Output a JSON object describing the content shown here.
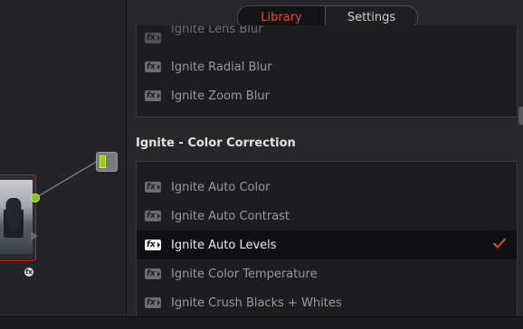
{
  "tabs": {
    "library": "Library",
    "settings": "Settings"
  },
  "colors": {
    "accent_red": "#e0493c",
    "node_green": "#8cc31b",
    "node_border_red": "#b8251c"
  },
  "node_editor": {
    "source_node_icon": "fx-badge-icon",
    "output_node_icon": "output-node-icon"
  },
  "blur_section": {
    "items": [
      {
        "label": "Ignite Lens Blur",
        "icon": "fx-icon"
      },
      {
        "label": "Ignite Radial Blur",
        "icon": "fx-icon"
      },
      {
        "label": "Ignite Zoom Blur",
        "icon": "fx-icon"
      }
    ]
  },
  "color_section": {
    "title": "Ignite - Color Correction",
    "items": [
      {
        "label": "Ignite Auto Color",
        "icon": "fx-icon"
      },
      {
        "label": "Ignite Auto Contrast",
        "icon": "fx-icon"
      },
      {
        "label": "Ignite Auto Levels",
        "icon": "fx-icon",
        "selected": true
      },
      {
        "label": "Ignite Color Temperature",
        "icon": "fx-icon"
      },
      {
        "label": "Ignite Crush Blacks + Whites",
        "icon": "fx-icon"
      }
    ]
  }
}
